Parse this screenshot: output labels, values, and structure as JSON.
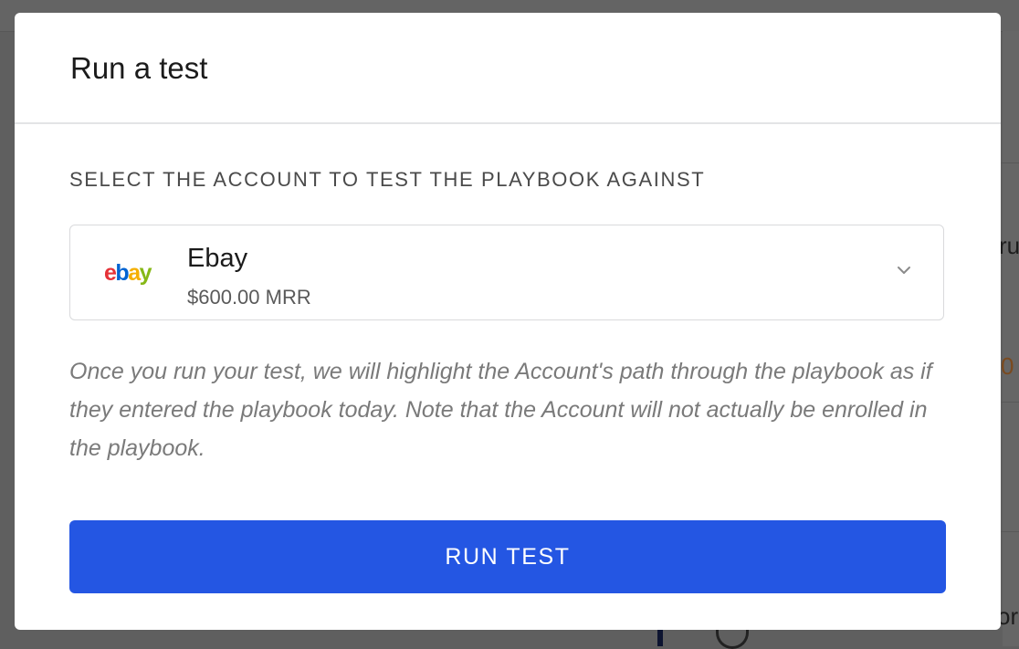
{
  "modal": {
    "title": "Run a test",
    "section_label": "SELECT THE ACCOUNT TO TEST THE PLAYBOOK AGAINST",
    "account": {
      "logo_text": "ebay",
      "logo_icon": "ebay-logo",
      "name": "Ebay",
      "mrr": "$600.00 MRR",
      "dropdown_icon": "chevron-down-icon"
    },
    "help_text": "Once you run your test, we will highlight the Account's path through the playbook as if they entered the playbook today. Note that the Account will not actually be enrolled in the playbook.",
    "button_label": "RUN TEST"
  },
  "background": {
    "fragment_1": "ru",
    "fragment_2": "0",
    "fragment_3": "or"
  },
  "colors": {
    "overlay": "#5f5f5f",
    "primary_button": "#2456e3",
    "logo_e": "#e53238",
    "logo_b": "#0064d2",
    "logo_a": "#f5af02",
    "logo_y": "#86b817"
  }
}
